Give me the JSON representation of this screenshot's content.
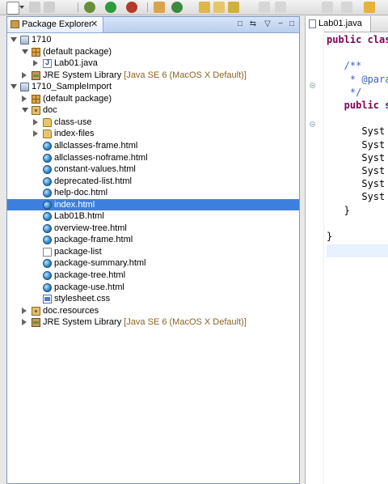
{
  "package_explorer": {
    "title": "Package Explorer",
    "close_glyph": "✕",
    "header_buttons": [
      "□",
      "⇆",
      "▽",
      "−",
      "□"
    ]
  },
  "tree": [
    {
      "label": "1710",
      "deco": "",
      "icon": "project",
      "level": 0,
      "expand": "exp"
    },
    {
      "label": "(default package)",
      "deco": "",
      "icon": "package",
      "level": 1,
      "expand": "exp"
    },
    {
      "label": "Lab01.java",
      "deco": "",
      "icon": "java",
      "level": 2,
      "expand": "col"
    },
    {
      "label": "JRE System Library",
      "deco": " [Java SE 6 (MacOS X Default)]",
      "icon": "jar",
      "level": 1,
      "expand": "col"
    },
    {
      "label": "1710_SampleImport",
      "deco": "",
      "icon": "project",
      "level": 0,
      "expand": "exp"
    },
    {
      "label": "(default package)",
      "deco": "",
      "icon": "package",
      "level": 1,
      "expand": "col"
    },
    {
      "label": "doc",
      "deco": "",
      "icon": "folderpkg",
      "level": 1,
      "expand": "exp"
    },
    {
      "label": "class-use",
      "deco": "",
      "icon": "folder",
      "level": 2,
      "expand": "col"
    },
    {
      "label": "index-files",
      "deco": "",
      "icon": "folder",
      "level": 2,
      "expand": "col"
    },
    {
      "label": "allclasses-frame.html",
      "deco": "",
      "icon": "html",
      "level": 2,
      "expand": ""
    },
    {
      "label": "allclasses-noframe.html",
      "deco": "",
      "icon": "html",
      "level": 2,
      "expand": ""
    },
    {
      "label": "constant-values.html",
      "deco": "",
      "icon": "html",
      "level": 2,
      "expand": ""
    },
    {
      "label": "deprecated-list.html",
      "deco": "",
      "icon": "html",
      "level": 2,
      "expand": ""
    },
    {
      "label": "help-doc.html",
      "deco": "",
      "icon": "html",
      "level": 2,
      "expand": ""
    },
    {
      "label": "index.html",
      "deco": "",
      "icon": "html",
      "level": 2,
      "expand": "",
      "selected": true
    },
    {
      "label": "Lab01B.html",
      "deco": "",
      "icon": "html",
      "level": 2,
      "expand": ""
    },
    {
      "label": "overview-tree.html",
      "deco": "",
      "icon": "html",
      "level": 2,
      "expand": ""
    },
    {
      "label": "package-frame.html",
      "deco": "",
      "icon": "html",
      "level": 2,
      "expand": ""
    },
    {
      "label": "package-list",
      "deco": "",
      "icon": "file",
      "level": 2,
      "expand": ""
    },
    {
      "label": "package-summary.html",
      "deco": "",
      "icon": "html",
      "level": 2,
      "expand": ""
    },
    {
      "label": "package-tree.html",
      "deco": "",
      "icon": "html",
      "level": 2,
      "expand": ""
    },
    {
      "label": "package-use.html",
      "deco": "",
      "icon": "html",
      "level": 2,
      "expand": ""
    },
    {
      "label": "stylesheet.css",
      "deco": "",
      "icon": "css",
      "level": 2,
      "expand": ""
    },
    {
      "label": "doc.resources",
      "deco": "",
      "icon": "folderpkg",
      "level": 1,
      "expand": "col"
    },
    {
      "label": "JRE System Library",
      "deco": " [Java SE 6 (MacOS X Default)]",
      "icon": "jar",
      "level": 1,
      "expand": "col"
    }
  ],
  "editor": {
    "tab_label": "Lab01.java",
    "lines": [
      {
        "text": "public class",
        "kind": "kw"
      },
      {
        "text": "",
        "kind": ""
      },
      {
        "text": "   /**",
        "kind": "cmt"
      },
      {
        "text": "    * @para",
        "kind": "cmt"
      },
      {
        "text": "    */",
        "kind": "cmt"
      },
      {
        "text": "   public s",
        "kind": "kw"
      },
      {
        "text": "",
        "kind": ""
      },
      {
        "text": "      Syst",
        "kind": ""
      },
      {
        "text": "      Syst",
        "kind": ""
      },
      {
        "text": "      Syst",
        "kind": ""
      },
      {
        "text": "      Syst",
        "kind": ""
      },
      {
        "text": "      Syst",
        "kind": ""
      },
      {
        "text": "      Syst",
        "kind": ""
      },
      {
        "text": "   }",
        "kind": ""
      },
      {
        "text": "",
        "kind": ""
      },
      {
        "text": "}",
        "kind": ""
      }
    ]
  }
}
